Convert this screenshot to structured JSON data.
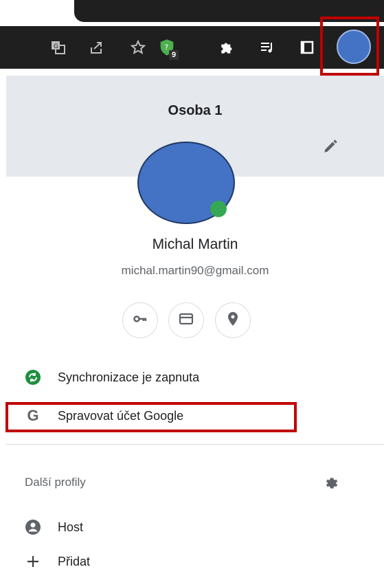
{
  "panel": {
    "title": "Osoba 1",
    "user_name": "Michal Martin",
    "user_email": "michal.martin90@gmail.com"
  },
  "extension_badge": "9",
  "sync": {
    "label": "Synchronizace je zapnuta"
  },
  "google_account": {
    "label": "Spravovat účet Google"
  },
  "other_profiles": {
    "title": "Další profily",
    "items": [
      {
        "label": "Host",
        "icon": "person-icon"
      },
      {
        "label": "Přidat",
        "icon": "plus-icon"
      }
    ]
  },
  "icons": {
    "toolbar": [
      "translate-icon",
      "share-icon",
      "star-icon",
      "shield-extension-icon",
      "puzzle-icon",
      "media-list-icon",
      "side-panel-icon"
    ],
    "round_buttons": [
      "key-icon",
      "card-icon",
      "location-icon"
    ]
  },
  "colors": {
    "avatar": "#4472c4",
    "highlight": "#c00000",
    "sync_green": "#1e8e3e",
    "header_bg": "#e5e8ec"
  }
}
